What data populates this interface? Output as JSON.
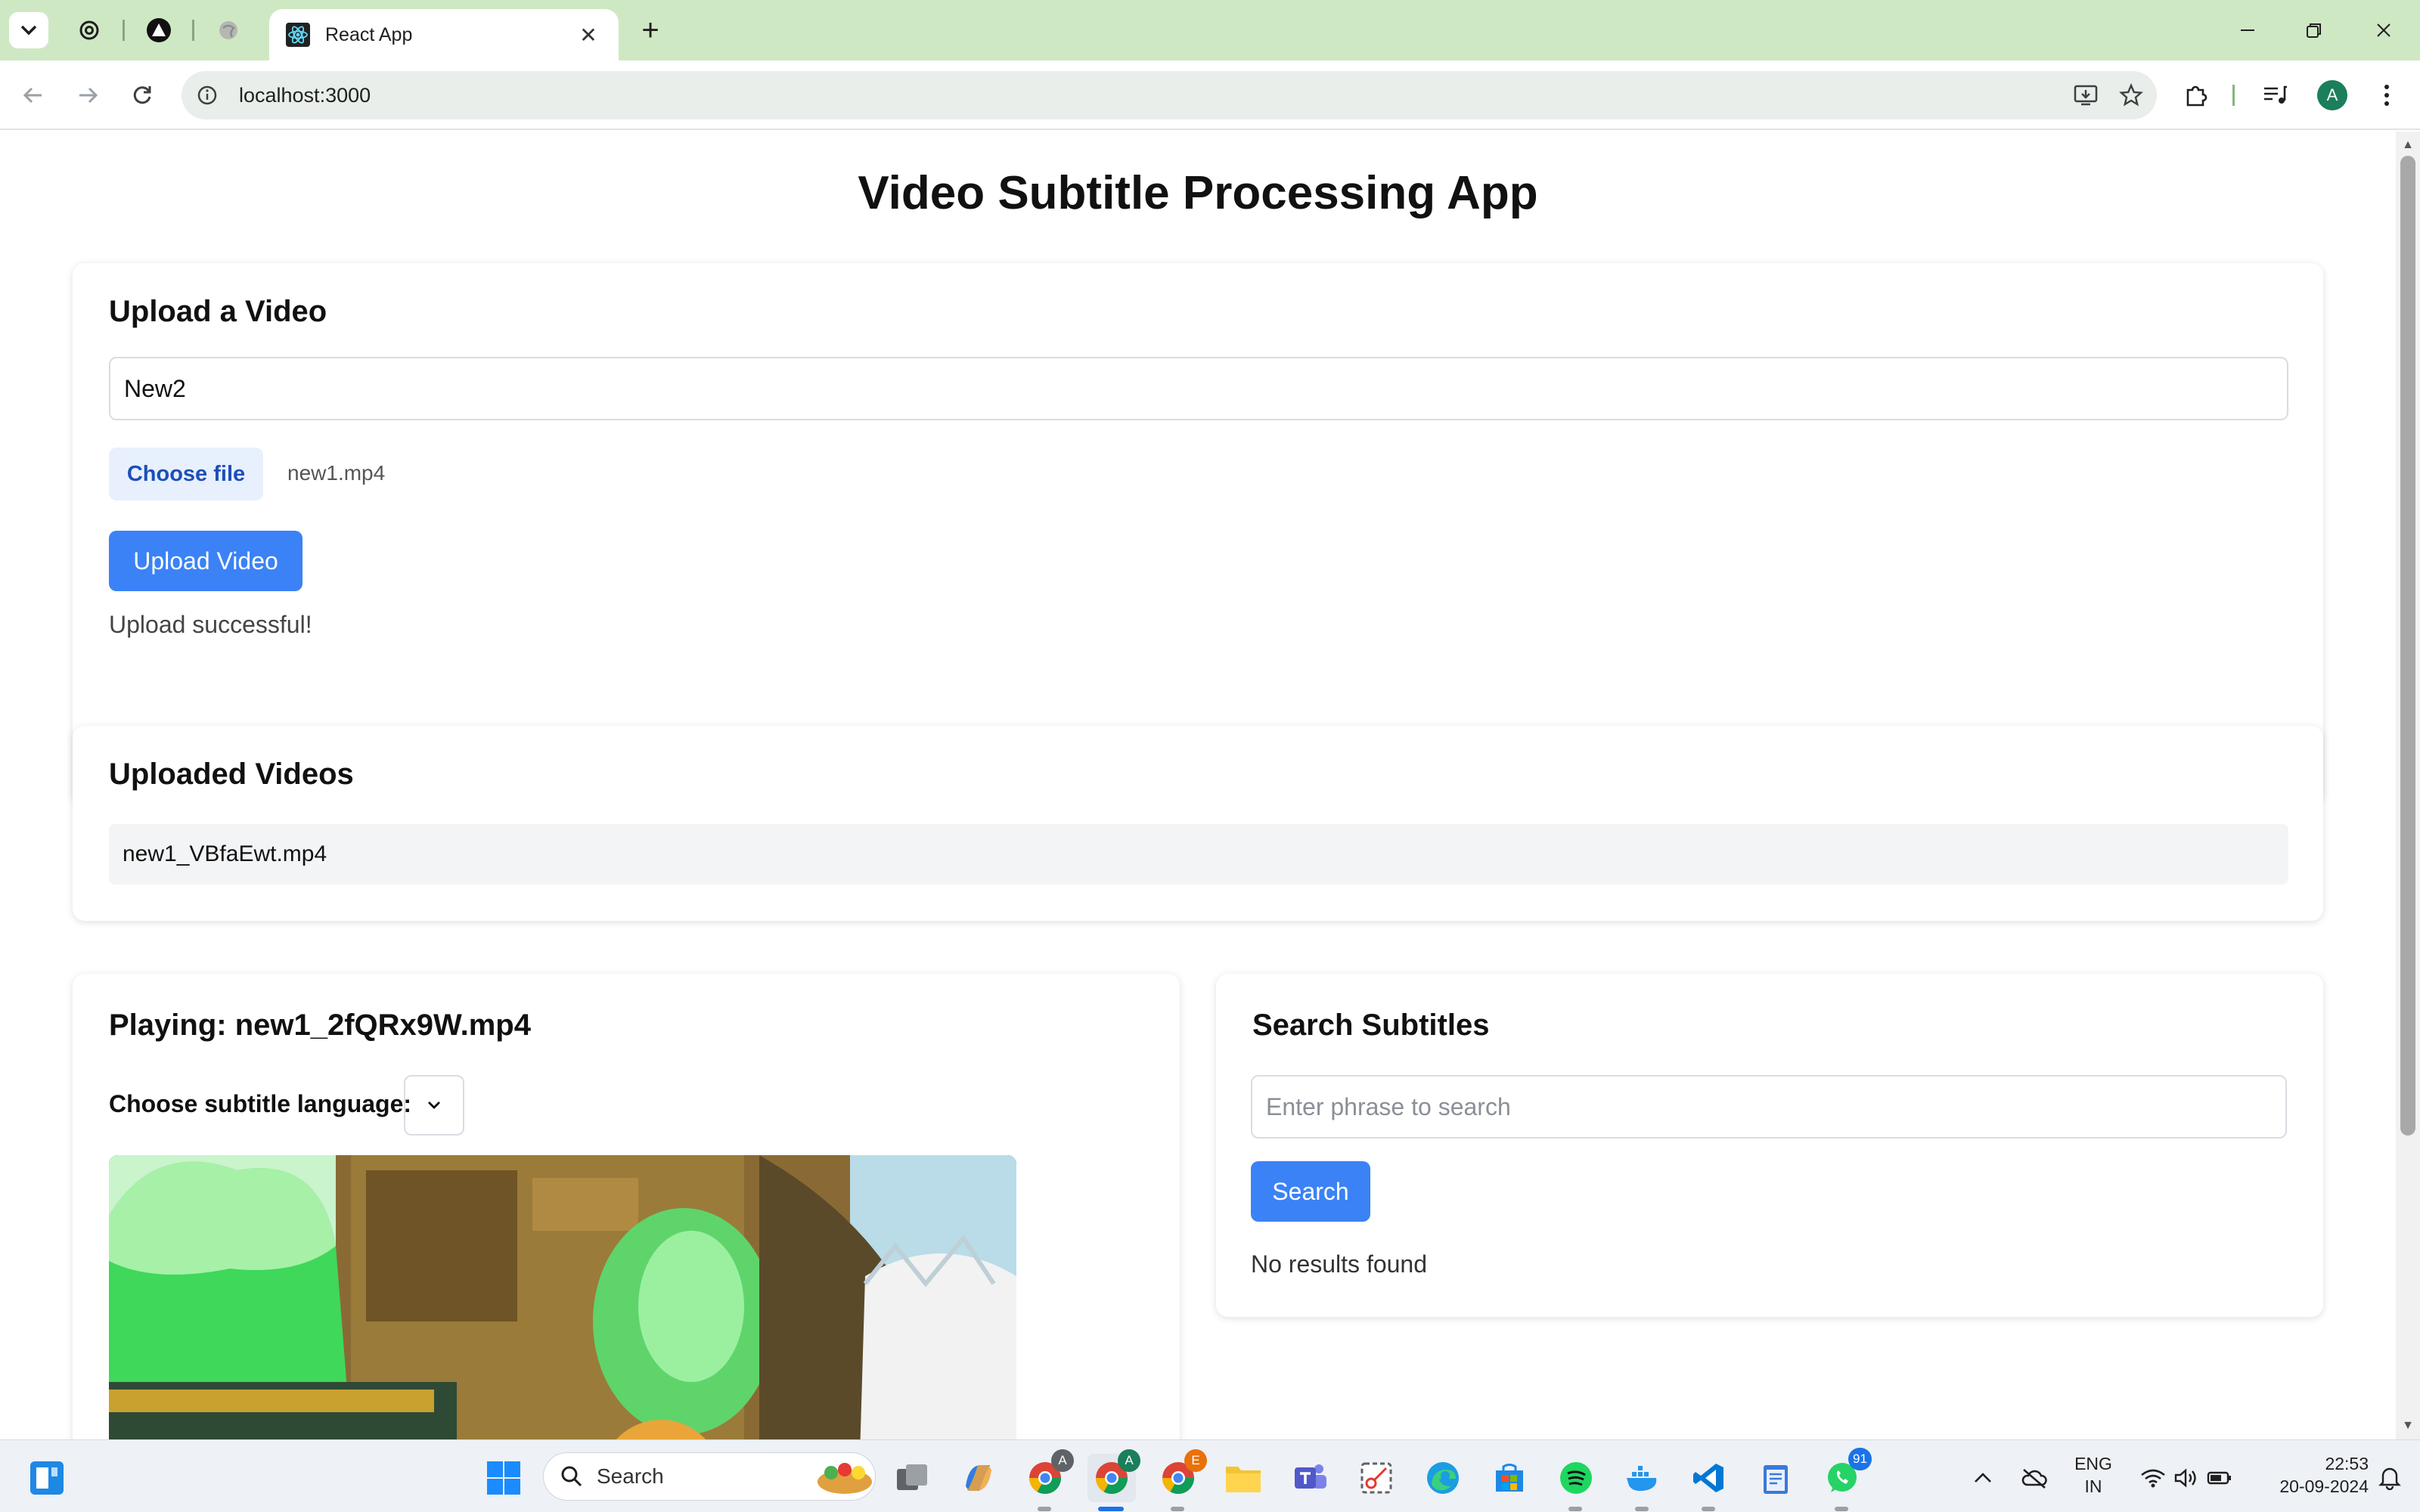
{
  "browser": {
    "active_tab_title": "React App",
    "url": "localhost:3000",
    "profile_initial": "A"
  },
  "page": {
    "title": "Video Subtitle Processing App",
    "upload": {
      "heading": "Upload a Video",
      "title_value": "New2",
      "choose_file_label": "Choose file",
      "file_name": "new1.mp4",
      "upload_button": "Upload Video",
      "status": "Upload successful!"
    },
    "uploaded": {
      "heading": "Uploaded Videos",
      "items": [
        "new1_VBfaEwt.mp4"
      ]
    },
    "player": {
      "heading": "Playing: new1_2fQRx9W.mp4",
      "language_label": "Choose subtitle language:",
      "language_value": ""
    },
    "search": {
      "heading": "Search Subtitles",
      "placeholder": "Enter phrase to search",
      "button": "Search",
      "result": "No results found"
    }
  },
  "taskbar": {
    "search_label": "Search",
    "lang_line1": "ENG",
    "lang_line2": "IN",
    "time": "22:53",
    "date": "20-09-2024",
    "whatsapp_badge": "91",
    "chrome_profile_1": "A",
    "chrome_profile_2": "A",
    "chrome_profile_3": "E"
  },
  "colors": {
    "tabstrip": "#cfe8c4",
    "accent": "#3b82f6",
    "choose_file_bg": "#e8f0fd",
    "choose_file_text": "#1c4fb8"
  }
}
